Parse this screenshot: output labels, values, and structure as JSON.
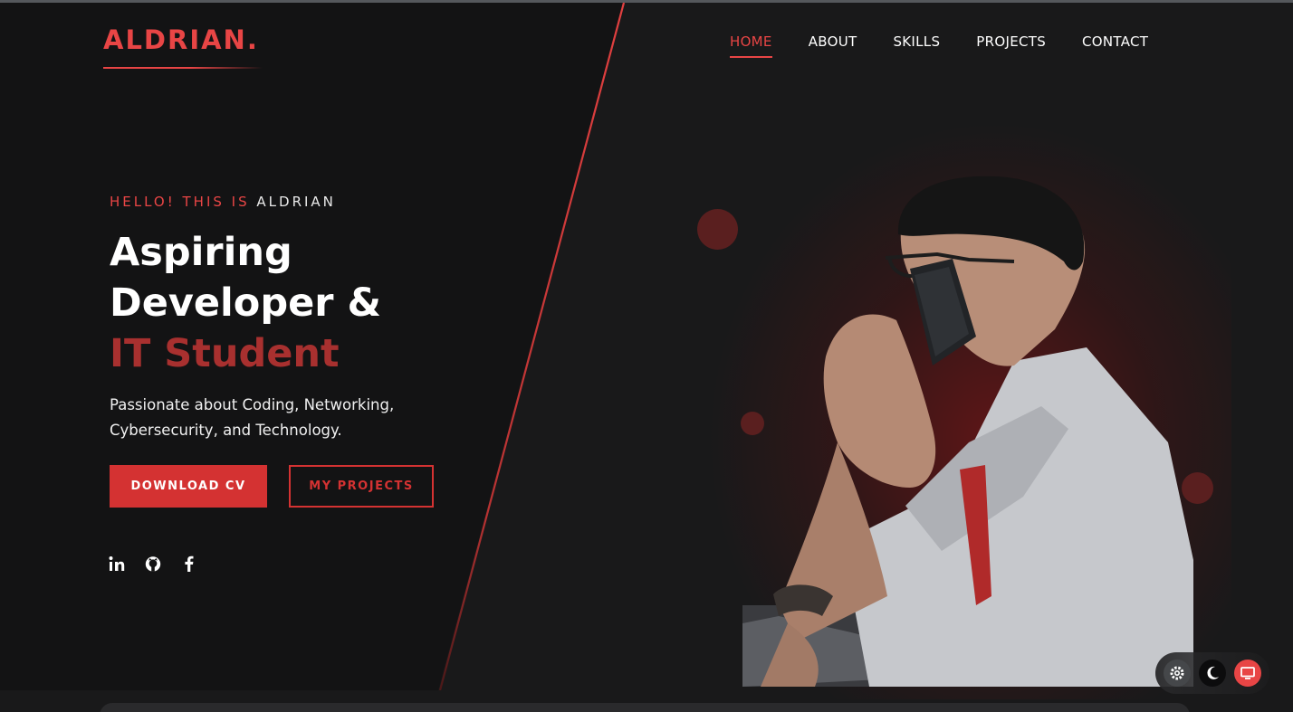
{
  "header": {
    "logo": "ALDRIAN.",
    "nav": [
      {
        "label": "HOME",
        "active": true
      },
      {
        "label": "ABOUT",
        "active": false
      },
      {
        "label": "SKILLS",
        "active": false
      },
      {
        "label": "PROJECTS",
        "active": false
      },
      {
        "label": "CONTACT",
        "active": false
      }
    ]
  },
  "hero": {
    "eyebrow_prefix": "HELLO! THIS IS",
    "eyebrow_name": "ALDRIAN",
    "headline_line1": "Aspiring",
    "headline_line2": "Developer &",
    "headline_accent": "IT Student",
    "tagline_line1": "Passionate about Coding, Networking,",
    "tagline_line2": "Cybersecurity, and Technology.",
    "buttons": {
      "primary": "DOWNLOAD CV",
      "secondary": "MY PROJECTS"
    },
    "socials": [
      "linkedin-icon",
      "github-icon",
      "facebook-icon"
    ]
  },
  "theme_switcher": {
    "options": [
      "gear-icon",
      "moon-icon",
      "monitor-icon"
    ],
    "selected": "monitor-icon"
  },
  "colors": {
    "accent": "#e84545",
    "button_red": "#d43232",
    "headline_accent": "#a8302f",
    "background": "#19191a"
  }
}
